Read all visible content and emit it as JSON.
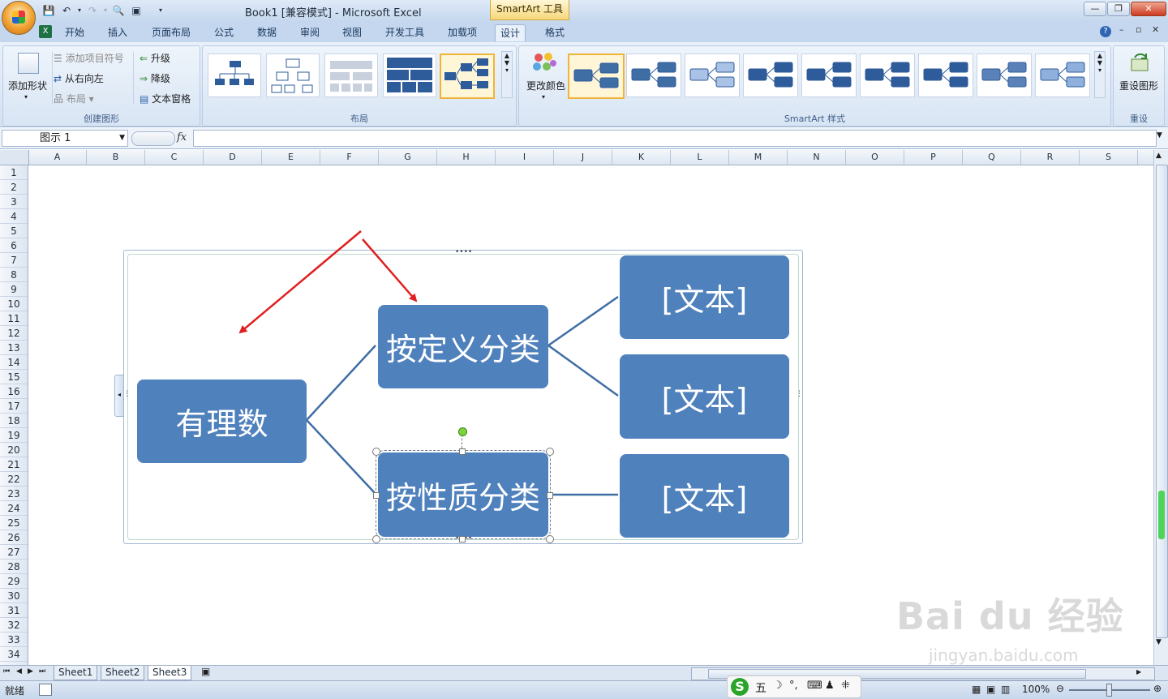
{
  "window": {
    "title": "Book1  [兼容模式] - Microsoft Excel",
    "contextual_tab_group": "SmartArt 工具",
    "buttons": {
      "minimize": "—",
      "restore": "❐",
      "close": "✕"
    }
  },
  "ribbon_tabs": [
    "开始",
    "插入",
    "页面布局",
    "公式",
    "数据",
    "审阅",
    "视图",
    "开发工具",
    "加载项",
    "设计",
    "格式"
  ],
  "ribbon": {
    "create_graphic": {
      "label": "创建图形",
      "add_shape": "添加形状",
      "add_bullet": "添加项目符号",
      "right_to_left": "从右向左",
      "layout": "布局",
      "promote": "升级",
      "demote": "降级",
      "text_pane": "文本窗格"
    },
    "layouts": {
      "label": "布局"
    },
    "styles": {
      "label": "SmartArt 样式",
      "change_colors": "更改颜色"
    },
    "reset": {
      "label": "重设",
      "reset_graphic": "重设图形"
    }
  },
  "formula_bar": {
    "name_box": "图示 1",
    "fx": "fx",
    "value": ""
  },
  "columns": [
    "A",
    "B",
    "C",
    "D",
    "E",
    "F",
    "G",
    "H",
    "I",
    "J",
    "K",
    "L",
    "M",
    "N",
    "O",
    "P",
    "Q",
    "R",
    "S"
  ],
  "rows": [
    "1",
    "2",
    "3",
    "4",
    "5",
    "6",
    "7",
    "8",
    "9",
    "10",
    "11",
    "12",
    "13",
    "14",
    "15",
    "16",
    "17",
    "18",
    "19",
    "20",
    "21",
    "22",
    "23",
    "24",
    "25",
    "26",
    "27",
    "28",
    "29",
    "30",
    "31",
    "32",
    "33",
    "34"
  ],
  "smartart": {
    "root": "有理数",
    "branch1": "按定义分类",
    "branch2": "按性质分类",
    "leaf1": "[文本]",
    "leaf2": "[文本]",
    "leaf3": "[文本]",
    "box_color": "#4f81bd",
    "line_color": "#3f6ea5",
    "arrow_color": "#e02020"
  },
  "sheets": [
    "Sheet1",
    "Sheet2",
    "Sheet3"
  ],
  "status": {
    "ready": "就绪",
    "zoom": "100%",
    "ime": "五"
  },
  "watermark": {
    "brand": "Bai du 经验",
    "url": "jingyan.baidu.com"
  }
}
